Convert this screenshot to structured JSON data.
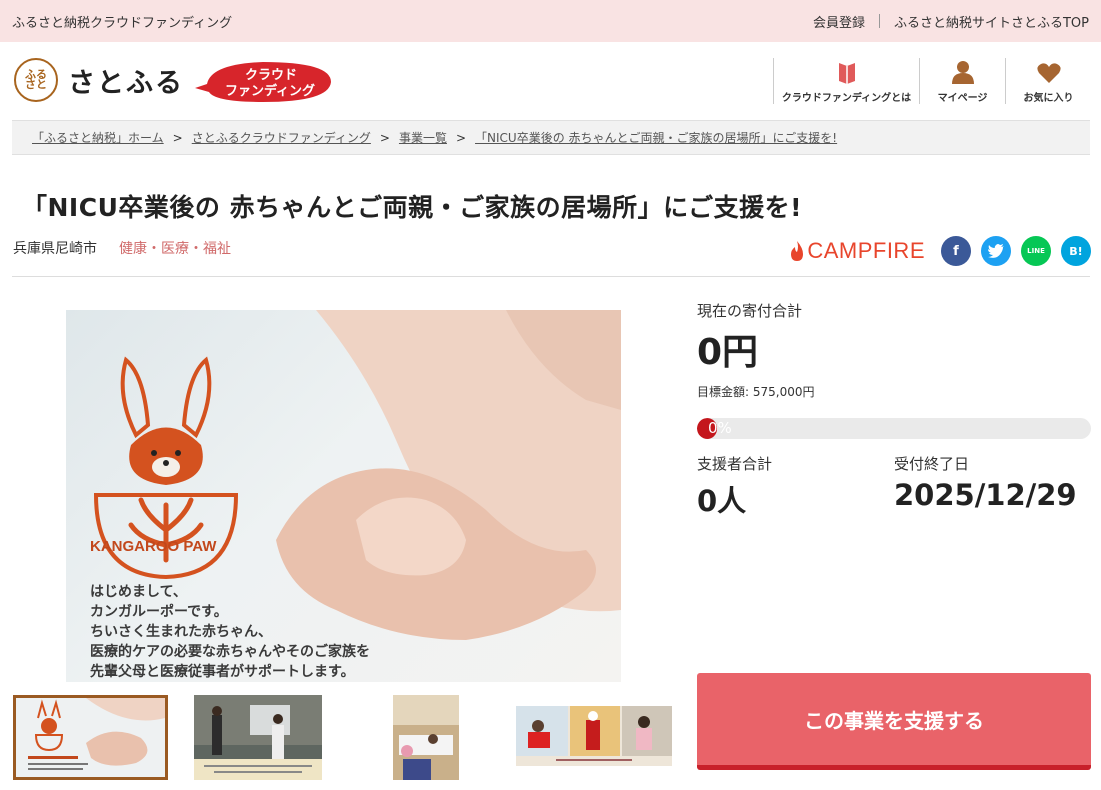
{
  "topbar": {
    "site_label": "ふるさと納税クラウドファンディング",
    "register": "会員登録",
    "site_top": "ふるさと納税サイトさとふるTOP"
  },
  "logo": {
    "seal_lines": [
      "ふる",
      "さと"
    ],
    "name": "さとふる"
  },
  "badge": {
    "line1": "クラウド",
    "line2": "ファンディング"
  },
  "nav": {
    "about": "クラウドファンディングとは",
    "mypage": "マイページ",
    "favorites": "お気に入り"
  },
  "breadcrumb": [
    "「ふるさと納税」ホーム",
    "さとふるクラウドファンディング",
    "事業一覧",
    "「NICU卒業後の 赤ちゃんとご両親・ご家族の居場所」にご支援を!"
  ],
  "project": {
    "title": "「NICU卒業後の 赤ちゃんとご両親・ご家族の居場所」にご支援を!",
    "location": "兵庫県尼崎市",
    "category": "健康・医療・福祉"
  },
  "social": {
    "campfire": "CAMPFIRE",
    "facebook": "f",
    "line": "LINE",
    "hatena": "B!"
  },
  "image": {
    "brand": "KANGAROO PAW",
    "lines": [
      "はじめまして、",
      "カンガルーポーです。",
      "ちいさく生まれた赤ちゃん、",
      "医療的ケアの必要な赤ちゃんやそのご家族を",
      "先輩父母と医療従事者がサポートします。"
    ]
  },
  "funding": {
    "current_label": "現在の寄付合計",
    "current_amount": "0円",
    "target": "目標金額: 575,000円",
    "progress_percent": 0,
    "progress_text": "0%",
    "supporters_label": "支援者合計",
    "supporters": "0人",
    "deadline_label": "受付終了日",
    "deadline": "2025/12/29"
  },
  "cta": {
    "label": "この事業を支援する"
  },
  "colors": {
    "accent": "#e96369",
    "progress": "#c4161c",
    "topbar": "#f9e3e3",
    "brand_orange": "#d4521f"
  }
}
